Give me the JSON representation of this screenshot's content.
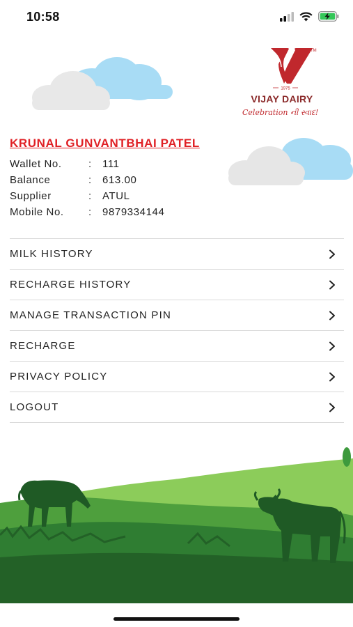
{
  "status_bar": {
    "time": "10:58"
  },
  "brand": {
    "year": "1975",
    "name": "VIJAY DAIRY",
    "tagline": "Celebration ની સ્વાદ!",
    "tm": "TM"
  },
  "profile": {
    "name": "KRUNAL GUNVANTBHAI PATEL",
    "separator": ":",
    "fields": [
      {
        "label": "Wallet No.",
        "value": "111"
      },
      {
        "label": "Balance",
        "value": "613.00"
      },
      {
        "label": "Supplier",
        "value": "ATUL"
      },
      {
        "label": "Mobile No.",
        "value": "9879334144"
      }
    ]
  },
  "menu": {
    "items": [
      {
        "label": "MILK HISTORY"
      },
      {
        "label": "RECHARGE HISTORY"
      },
      {
        "label": "MANAGE TRANSACTION PIN"
      },
      {
        "label": "RECHARGE"
      },
      {
        "label": "PRIVACY POLICY"
      },
      {
        "label": "LOGOUT"
      }
    ]
  },
  "colors": {
    "brand_red": "#e02025",
    "logo_red": "#c0282d",
    "grass_dark": "#2f7d32",
    "grass_light": "#7cc24f",
    "cloud_blue": "#a8dcf5",
    "cloud_gray": "#e6e6e6"
  },
  "icons": {
    "signal": "cellular-signal-icon",
    "wifi": "wifi-icon",
    "battery": "battery-charging-icon",
    "chevron": "chevron-right-icon"
  }
}
